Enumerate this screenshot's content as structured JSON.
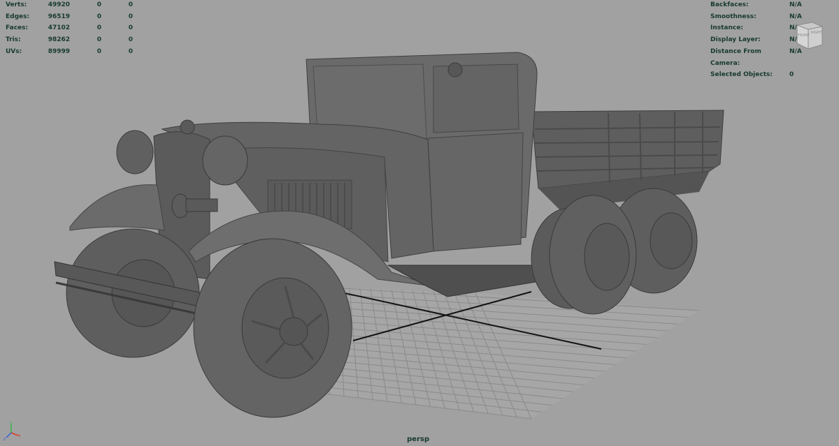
{
  "heads_up_left": [
    {
      "label": "Verts:",
      "values": [
        "49920",
        "0",
        "0"
      ]
    },
    {
      "label": "Edges:",
      "values": [
        "96519",
        "0",
        "0"
      ]
    },
    {
      "label": "Faces:",
      "values": [
        "47102",
        "0",
        "0"
      ]
    },
    {
      "label": "Tris:",
      "values": [
        "98262",
        "0",
        "0"
      ]
    },
    {
      "label": "UVs:",
      "values": [
        "89999",
        "0",
        "0"
      ]
    }
  ],
  "heads_up_right": [
    {
      "label": "Backfaces:",
      "value": "N/A"
    },
    {
      "label": "Smoothness:",
      "value": "N/A"
    },
    {
      "label": "Instance:",
      "value": "N/A"
    },
    {
      "label": "Display Layer:",
      "value": "N/A"
    },
    {
      "label": "Distance From Camera:",
      "value": "N/A"
    },
    {
      "label": "Selected Objects:",
      "value": "0"
    }
  ],
  "view_cube": {
    "front_label": "FRONT",
    "right_label": "RIGHT"
  },
  "camera_label": "persp",
  "axis_gizmo": {
    "x": "x",
    "y": "y",
    "z": "z",
    "x_color": "#d43a2a",
    "y_color": "#3bb54a",
    "z_color": "#3a5fd4"
  },
  "colors": {
    "viewport_bg": "#a1a1a1",
    "hud_text": "#173a2e",
    "grid": "#7f7f7f",
    "grid_axis": "#111111",
    "model": "#6a6a6a"
  }
}
